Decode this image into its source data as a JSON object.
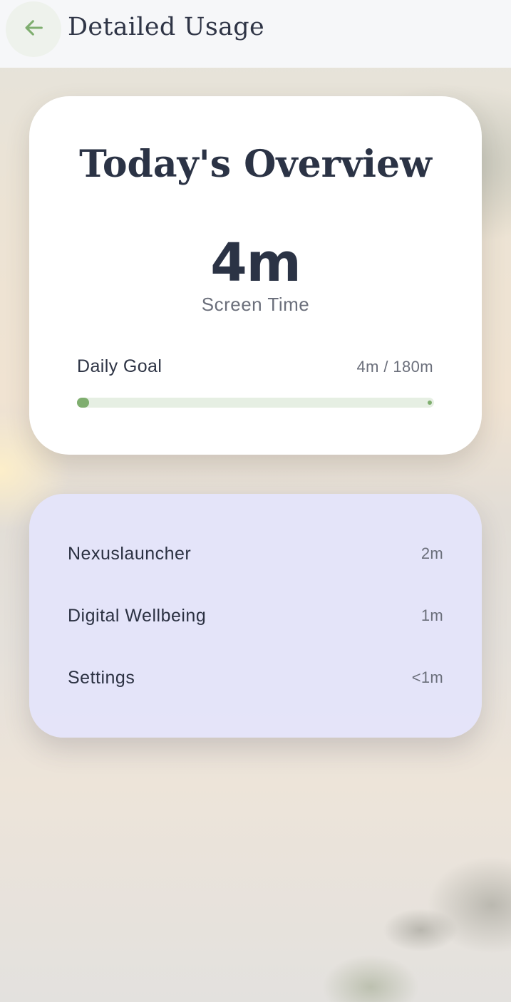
{
  "header": {
    "title": "Detailed Usage",
    "back_icon": "arrow-left-icon"
  },
  "overview": {
    "title": "Today's Overview",
    "screen_time": "4m",
    "screen_time_label": "Screen Time",
    "goal_label": "Daily Goal",
    "goal_value": "4m / 180m",
    "goal_progress_fraction": 0.022
  },
  "apps": [
    {
      "name": "Nexuslauncher",
      "time": "2m"
    },
    {
      "name": "Digital Wellbeing",
      "time": "1m"
    },
    {
      "name": "Settings",
      "time": "<1m"
    }
  ],
  "colors": {
    "accent_green": "#7fae6f",
    "track_green": "#e6efe3",
    "text_dark": "#2b3345",
    "text_muted": "#6b6f7b",
    "apps_card_bg": "#e4e4fa"
  }
}
